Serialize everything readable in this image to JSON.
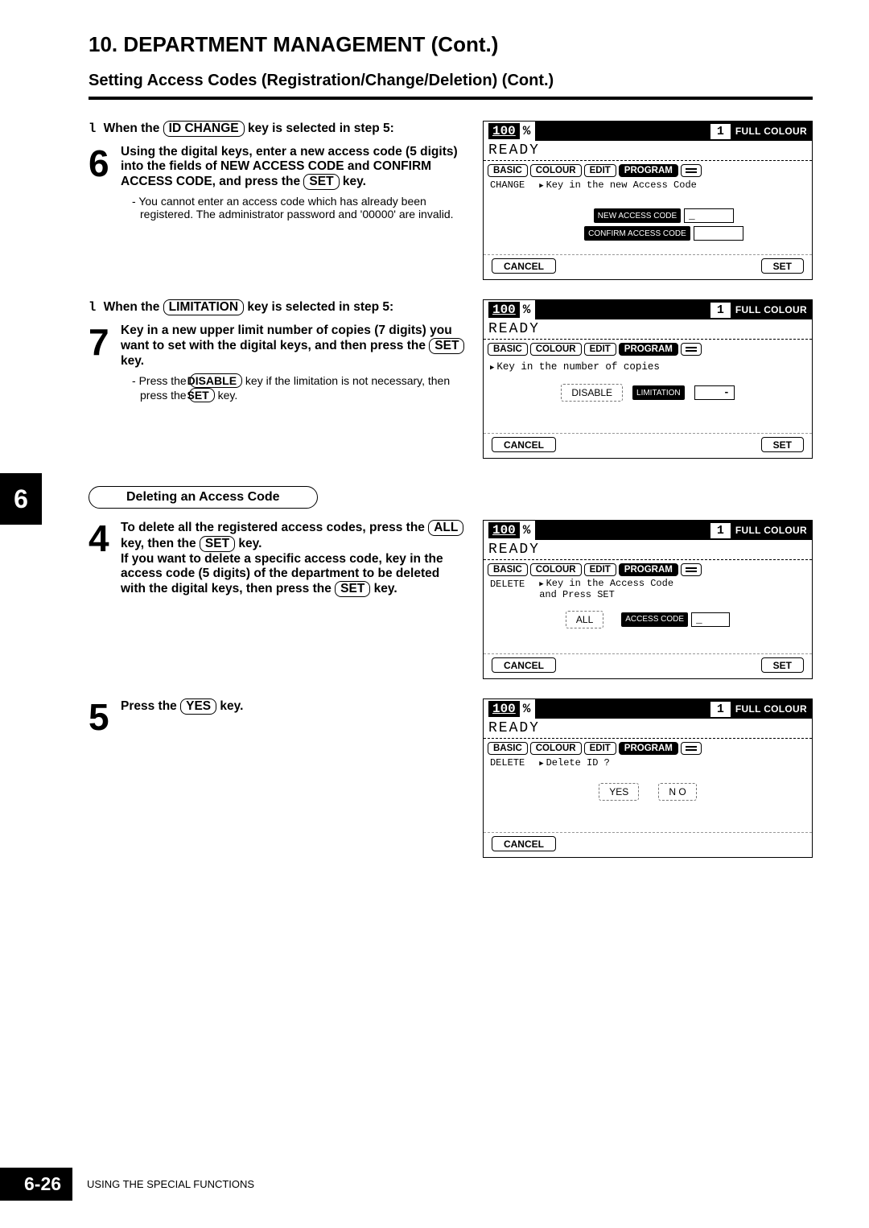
{
  "chapter": "10. DEPARTMENT MANAGEMENT (Cont.)",
  "section": "Setting Access Codes (Registration/Change/Deletion) (Cont.)",
  "side_tab": "6",
  "footer": {
    "page": "6-26",
    "text": "USING THE SPECIAL FUNCTIONS"
  },
  "sub": {
    "deleting": "Deleting an Access Code"
  },
  "steps": {
    "l6_pre": "When the ",
    "l6_key": "ID CHANGE",
    "l6_post": " key is selected in step 5:",
    "s6_num": "6",
    "s6_a": "Using the digital keys, enter a new access code (5 digits) into the fields of NEW ACCESS CODE and CONFIRM ACCESS CODE, and press the ",
    "s6_setkey": "SET",
    "s6_b": " key.",
    "s6_note": "You cannot enter an access code which has already been registered. The administrator password and '00000' are invalid.",
    "l7_pre": "When the  ",
    "l7_key": "LIMITATION",
    "l7_post": " key is selected in step 5:",
    "s7_num": "7",
    "s7_a": "Key in a new upper limit number of copies (7 digits) you want to set  with the digital keys, and then press the ",
    "s7_setkey": "SET",
    "s7_b": " key.",
    "s7_note_a": "Press the ",
    "s7_note_key": "DISABLE",
    "s7_note_b": " key if the limitation is not necessary, then press the ",
    "s7_note_set": "SET",
    "s7_note_c": " key.",
    "s4_num": "4",
    "s4_a": "To delete all the registered access codes,  press the ",
    "s4_all": "ALL",
    "s4_b": " key, then the ",
    "s4_set": "SET",
    "s4_c": " key.",
    "s4_d": "If you want to delete a specific access code,  key in the access code (5 digits) of the department to be deleted with the digital keys, then press the  ",
    "s4_set2": "SET",
    "s4_e": " key.",
    "s5_num": "5",
    "s5_a": "Press the ",
    "s5_yes": "YES",
    "s5_b": " key."
  },
  "lcd_common": {
    "zoom": "100",
    "pct": "%",
    "count": "1",
    "mode": "FULL COLOUR",
    "ready": "READY",
    "tabs": {
      "basic": "BASIC",
      "colour": "COLOUR",
      "edit": "EDIT",
      "program": "PROGRAM"
    },
    "cancel": "CANCEL",
    "set": "SET"
  },
  "lcd1": {
    "ctx_left": "CHANGE",
    "ctx_right": "Key in the new Access Code",
    "f1": "NEW ACCESS CODE",
    "f2": "CONFIRM ACCESS CODE",
    "val": "_"
  },
  "lcd2": {
    "prompt": "Key in the number of copies",
    "disable": "DISABLE",
    "limitation": "LIMITATION",
    "val": "-"
  },
  "lcd3": {
    "ctx_left": "DELETE",
    "ctx_right_1": "Key in the Access Code",
    "ctx_right_2": "and Press SET",
    "all": "ALL",
    "access": "ACCESS CODE",
    "val": "_"
  },
  "lcd4": {
    "ctx_left": "DELETE",
    "ctx_right": "Delete ID ?",
    "yes": "YES",
    "no": "N O"
  }
}
